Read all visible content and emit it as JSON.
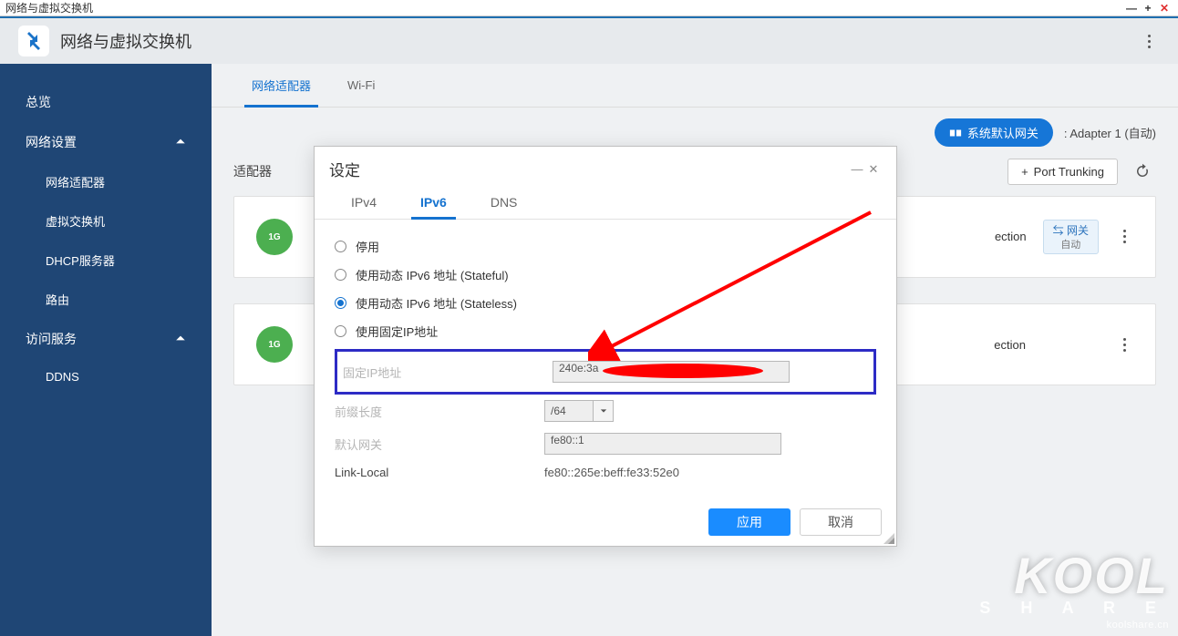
{
  "window": {
    "title": "网络与虚拟交换机"
  },
  "header": {
    "title": "网络与虚拟交换机"
  },
  "sidebar": {
    "overview": "总览",
    "network_settings": "网络设置",
    "adapters": "网络适配器",
    "vswitch": "虚拟交换机",
    "dhcp": "DHCP服务器",
    "route": "路由",
    "access_services": "访问服务",
    "ddns": "DDNS"
  },
  "tabs": {
    "adapters": "网络适配器",
    "wifi": "Wi-Fi"
  },
  "toolbar": {
    "section_title": "适配器",
    "sys_gateway": "系统默认网关",
    "gateway_adapter_label": ": Adapter 1 (自动)",
    "port_trunking": "Port Trunking"
  },
  "cards": {
    "speed": "1G",
    "connection_suffix": "ection",
    "gateway_chip": "网关",
    "gateway_chip_sub": "自动"
  },
  "modal": {
    "title": "设定",
    "tabs": {
      "ipv4": "IPv4",
      "ipv6": "IPv6",
      "dns": "DNS"
    },
    "radios": {
      "disable": "停用",
      "stateful": "使用动态 IPv6 地址 (Stateful)",
      "stateless": "使用动态 IPv6 地址 (Stateless)",
      "static": "使用固定IP地址"
    },
    "labels": {
      "fixed_ip": "固定IP地址",
      "prefix_len": "前缀长度",
      "default_gw": "默认网关",
      "link_local": "Link-Local"
    },
    "values": {
      "fixed_ip": "240e:3a",
      "prefix_len": "/64",
      "default_gw": "fe80::1",
      "link_local": "fe80::265e:beff:fe33:52e0"
    },
    "buttons": {
      "apply": "应用",
      "cancel": "取消"
    }
  },
  "watermark": {
    "brand": "KOOL",
    "share": "S H A R E",
    "url": "koolshare.cn"
  }
}
